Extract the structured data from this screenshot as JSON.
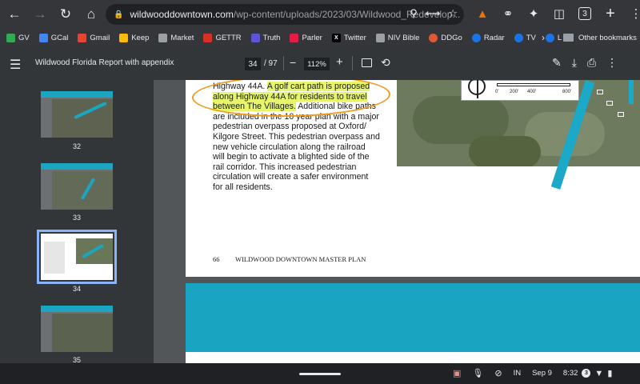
{
  "browser": {
    "address": {
      "host": "wildwooddowntown.com",
      "path": "/wp-content/uploads/2023/03/Wildwood_Redevelop..."
    },
    "tab_count": "3"
  },
  "bookmarks": [
    {
      "label": "GV",
      "color": "#34a853"
    },
    {
      "label": "GCal",
      "color": "#4285f4"
    },
    {
      "label": "Gmail",
      "color": "#ea4335"
    },
    {
      "label": "Keep",
      "color": "#fbbc04"
    },
    {
      "label": "Market",
      "color": "#9aa0a6"
    },
    {
      "label": "GETTR",
      "color": "#d93025"
    },
    {
      "label": "Truth",
      "color": "#5c56d6"
    },
    {
      "label": "Parler",
      "color": "#e11d48"
    },
    {
      "label": "Twitter",
      "color": "#000000"
    },
    {
      "label": "NIV Bible",
      "color": "#9aa0a6"
    },
    {
      "label": "DDGo",
      "color": "#de5833"
    },
    {
      "label": "Radar",
      "color": "#1a73e8"
    },
    {
      "label": "TV",
      "color": "#1a73e8"
    },
    {
      "label": "L",
      "color": "#1a73e8"
    }
  ],
  "bookmarks_other": "Other bookmarks",
  "pdf": {
    "title": "Wildwood Florida Report with appendix",
    "current_page": "34",
    "total_pages": "/ 97",
    "zoom": "112%"
  },
  "thumbnails": [
    {
      "label": "32"
    },
    {
      "label": "33"
    },
    {
      "label": "34"
    },
    {
      "label": "35"
    }
  ],
  "page": {
    "lines": [
      {
        "pre": "Highway 44A. ",
        "hl": "A golf cart path is proposed",
        "post": ""
      },
      {
        "pre": "",
        "hl": "along Highway 44A for residents to travel",
        "post": ""
      },
      {
        "pre": "",
        "hl": "between The Villages.",
        "post": " Additional bike paths"
      },
      {
        "pre": "are included in the 10 year plan with a major",
        "hl": "",
        "post": ""
      },
      {
        "pre": "pedestrian overpass proposed at Oxford/",
        "hl": "",
        "post": ""
      },
      {
        "pre": "Kilgore Street. This pedestrian overpass and",
        "hl": "",
        "post": ""
      },
      {
        "pre": "new vehicle circulation along the railroad",
        "hl": "",
        "post": ""
      },
      {
        "pre": "will begin to activate a blighted side of the",
        "hl": "",
        "post": ""
      },
      {
        "pre": "rail corridor.  This increased pedestrian",
        "hl": "",
        "post": ""
      },
      {
        "pre": "circulation will create a safer environment",
        "hl": "",
        "post": ""
      },
      {
        "pre": "for all residents.",
        "hl": "",
        "post": ""
      }
    ],
    "footer_number": "66",
    "footer_title": "WILDWOOD DOWNTOWN MASTER PLAN",
    "scale_labels": [
      "0'",
      "200'",
      "400'",
      "800'"
    ]
  },
  "shelf": {
    "ime": "IN",
    "date": "Sep 9",
    "time": "8:32",
    "notif": "3"
  }
}
